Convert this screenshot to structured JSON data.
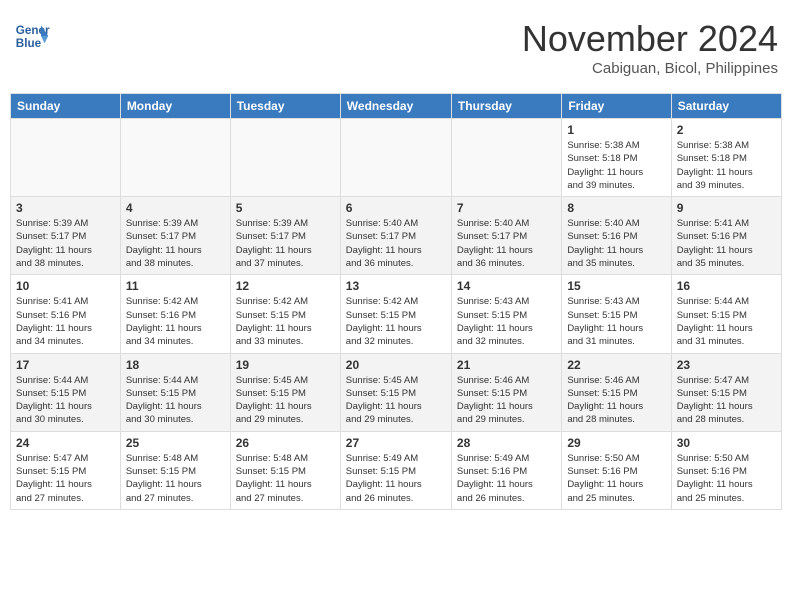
{
  "header": {
    "logo_line1": "General",
    "logo_line2": "Blue",
    "month": "November 2024",
    "location": "Cabiguan, Bicol, Philippines"
  },
  "weekdays": [
    "Sunday",
    "Monday",
    "Tuesday",
    "Wednesday",
    "Thursday",
    "Friday",
    "Saturday"
  ],
  "weeks": [
    [
      {
        "day": "",
        "info": ""
      },
      {
        "day": "",
        "info": ""
      },
      {
        "day": "",
        "info": ""
      },
      {
        "day": "",
        "info": ""
      },
      {
        "day": "",
        "info": ""
      },
      {
        "day": "1",
        "info": "Sunrise: 5:38 AM\nSunset: 5:18 PM\nDaylight: 11 hours\nand 39 minutes."
      },
      {
        "day": "2",
        "info": "Sunrise: 5:38 AM\nSunset: 5:18 PM\nDaylight: 11 hours\nand 39 minutes."
      }
    ],
    [
      {
        "day": "3",
        "info": "Sunrise: 5:39 AM\nSunset: 5:17 PM\nDaylight: 11 hours\nand 38 minutes."
      },
      {
        "day": "4",
        "info": "Sunrise: 5:39 AM\nSunset: 5:17 PM\nDaylight: 11 hours\nand 38 minutes."
      },
      {
        "day": "5",
        "info": "Sunrise: 5:39 AM\nSunset: 5:17 PM\nDaylight: 11 hours\nand 37 minutes."
      },
      {
        "day": "6",
        "info": "Sunrise: 5:40 AM\nSunset: 5:17 PM\nDaylight: 11 hours\nand 36 minutes."
      },
      {
        "day": "7",
        "info": "Sunrise: 5:40 AM\nSunset: 5:17 PM\nDaylight: 11 hours\nand 36 minutes."
      },
      {
        "day": "8",
        "info": "Sunrise: 5:40 AM\nSunset: 5:16 PM\nDaylight: 11 hours\nand 35 minutes."
      },
      {
        "day": "9",
        "info": "Sunrise: 5:41 AM\nSunset: 5:16 PM\nDaylight: 11 hours\nand 35 minutes."
      }
    ],
    [
      {
        "day": "10",
        "info": "Sunrise: 5:41 AM\nSunset: 5:16 PM\nDaylight: 11 hours\nand 34 minutes."
      },
      {
        "day": "11",
        "info": "Sunrise: 5:42 AM\nSunset: 5:16 PM\nDaylight: 11 hours\nand 34 minutes."
      },
      {
        "day": "12",
        "info": "Sunrise: 5:42 AM\nSunset: 5:15 PM\nDaylight: 11 hours\nand 33 minutes."
      },
      {
        "day": "13",
        "info": "Sunrise: 5:42 AM\nSunset: 5:15 PM\nDaylight: 11 hours\nand 32 minutes."
      },
      {
        "day": "14",
        "info": "Sunrise: 5:43 AM\nSunset: 5:15 PM\nDaylight: 11 hours\nand 32 minutes."
      },
      {
        "day": "15",
        "info": "Sunrise: 5:43 AM\nSunset: 5:15 PM\nDaylight: 11 hours\nand 31 minutes."
      },
      {
        "day": "16",
        "info": "Sunrise: 5:44 AM\nSunset: 5:15 PM\nDaylight: 11 hours\nand 31 minutes."
      }
    ],
    [
      {
        "day": "17",
        "info": "Sunrise: 5:44 AM\nSunset: 5:15 PM\nDaylight: 11 hours\nand 30 minutes."
      },
      {
        "day": "18",
        "info": "Sunrise: 5:44 AM\nSunset: 5:15 PM\nDaylight: 11 hours\nand 30 minutes."
      },
      {
        "day": "19",
        "info": "Sunrise: 5:45 AM\nSunset: 5:15 PM\nDaylight: 11 hours\nand 29 minutes."
      },
      {
        "day": "20",
        "info": "Sunrise: 5:45 AM\nSunset: 5:15 PM\nDaylight: 11 hours\nand 29 minutes."
      },
      {
        "day": "21",
        "info": "Sunrise: 5:46 AM\nSunset: 5:15 PM\nDaylight: 11 hours\nand 29 minutes."
      },
      {
        "day": "22",
        "info": "Sunrise: 5:46 AM\nSunset: 5:15 PM\nDaylight: 11 hours\nand 28 minutes."
      },
      {
        "day": "23",
        "info": "Sunrise: 5:47 AM\nSunset: 5:15 PM\nDaylight: 11 hours\nand 28 minutes."
      }
    ],
    [
      {
        "day": "24",
        "info": "Sunrise: 5:47 AM\nSunset: 5:15 PM\nDaylight: 11 hours\nand 27 minutes."
      },
      {
        "day": "25",
        "info": "Sunrise: 5:48 AM\nSunset: 5:15 PM\nDaylight: 11 hours\nand 27 minutes."
      },
      {
        "day": "26",
        "info": "Sunrise: 5:48 AM\nSunset: 5:15 PM\nDaylight: 11 hours\nand 27 minutes."
      },
      {
        "day": "27",
        "info": "Sunrise: 5:49 AM\nSunset: 5:15 PM\nDaylight: 11 hours\nand 26 minutes."
      },
      {
        "day": "28",
        "info": "Sunrise: 5:49 AM\nSunset: 5:16 PM\nDaylight: 11 hours\nand 26 minutes."
      },
      {
        "day": "29",
        "info": "Sunrise: 5:50 AM\nSunset: 5:16 PM\nDaylight: 11 hours\nand 25 minutes."
      },
      {
        "day": "30",
        "info": "Sunrise: 5:50 AM\nSunset: 5:16 PM\nDaylight: 11 hours\nand 25 minutes."
      }
    ]
  ]
}
